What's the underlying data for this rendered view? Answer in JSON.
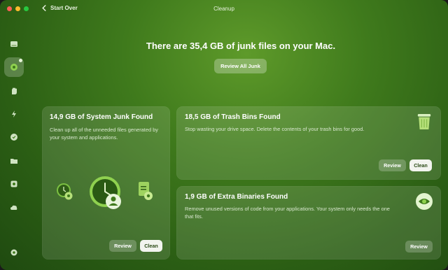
{
  "window": {
    "title": "Cleanup",
    "back_label": "Start Over"
  },
  "sidebar": {
    "items": [
      {
        "icon": "disk-icon"
      },
      {
        "icon": "cleanup-icon",
        "active": true
      },
      {
        "icon": "hand-icon"
      },
      {
        "icon": "lightning-icon"
      },
      {
        "icon": "shield-icon"
      },
      {
        "icon": "folder-icon"
      },
      {
        "icon": "apps-icon"
      },
      {
        "icon": "cloud-icon"
      },
      {
        "icon": "settings-icon"
      }
    ]
  },
  "header": {
    "headline": "There are 35,4 GB of junk files on your Mac.",
    "review_all_label": "Review All Junk"
  },
  "cards": {
    "system_junk": {
      "title": "14,9 GB of System Junk Found",
      "description": "Clean up all of the unneeded files generated by your system and applications.",
      "review_label": "Review",
      "clean_label": "Clean"
    },
    "trash_bins": {
      "title": "18,5 GB of Trash Bins Found",
      "description": "Stop wasting your drive space. Delete the contents of your trash bins for good.",
      "review_label": "Review",
      "clean_label": "Clean"
    },
    "extra_binaries": {
      "title": "1,9 GB of Extra Binaries Found",
      "description": "Remove unused versions of code from your applications. Your system only needs the one that fits.",
      "review_label": "Review"
    }
  },
  "colors": {
    "accent": "#3f7a1c",
    "clean_button": "#f2f4ef"
  }
}
